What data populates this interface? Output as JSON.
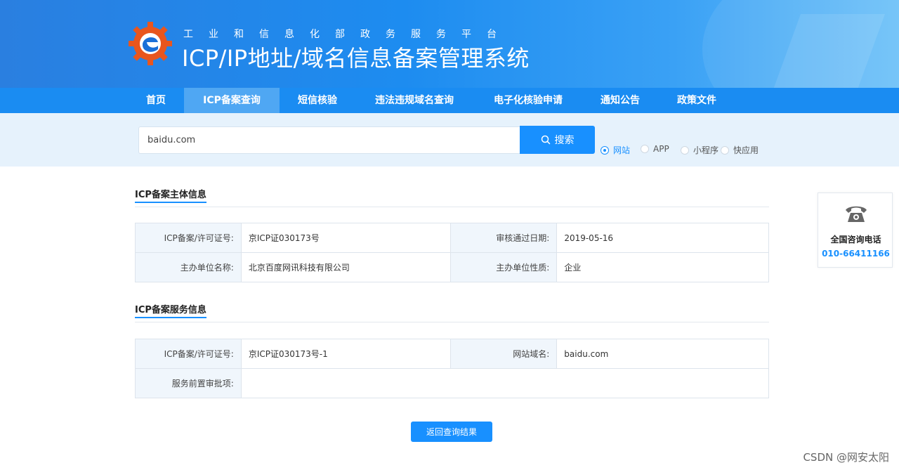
{
  "header": {
    "subtitle": "工业和信息化部政务服务平台",
    "title": "ICP/IP地址/域名信息备案管理系统"
  },
  "nav": {
    "items": [
      {
        "label": "首页"
      },
      {
        "label": "ICP备案查询",
        "active": true
      },
      {
        "label": "短信核验"
      },
      {
        "label": "违法违规域名查询"
      },
      {
        "label": "电子化核验申请"
      },
      {
        "label": "通知公告"
      },
      {
        "label": "政策文件"
      }
    ]
  },
  "search": {
    "value": "baidu.com",
    "button_label": "搜索",
    "button_icon": "search-icon",
    "types": [
      {
        "label": "网站",
        "checked": true
      },
      {
        "label": "APP",
        "checked": false
      },
      {
        "label": "小程序",
        "checked": false
      },
      {
        "label": "快应用",
        "checked": false
      }
    ]
  },
  "subject_info": {
    "title": "ICP备案主体信息",
    "rows": [
      {
        "label1": "ICP备案/许可证号:",
        "value1": "京ICP证030173号",
        "label2": "审核通过日期:",
        "value2": "2019-05-16"
      },
      {
        "label1": "主办单位名称:",
        "value1": "北京百度网讯科技有限公司",
        "label2": "主办单位性质:",
        "value2": "企业"
      }
    ]
  },
  "service_info": {
    "title": "ICP备案服务信息",
    "license_label": "ICP备案/许可证号:",
    "license_value": "京ICP证030173号-1",
    "domain_label": "网站域名:",
    "domain_value": "baidu.com",
    "approval_label": "服务前置审批项:",
    "approval_value": ""
  },
  "contact": {
    "icon": "telephone-icon",
    "label": "全国咨询电话",
    "phone": "010-66411166"
  },
  "back_button": "返回查询结果",
  "watermark": "CSDN @网安太阳",
  "colors": {
    "primary": "#1890ff",
    "nav_bg": "#1a8cf2",
    "nav_active": "#4fa7f3",
    "search_band": "#e6f2fc",
    "label_cell": "#f0f6fc",
    "logo_orange": "#e8561e"
  }
}
